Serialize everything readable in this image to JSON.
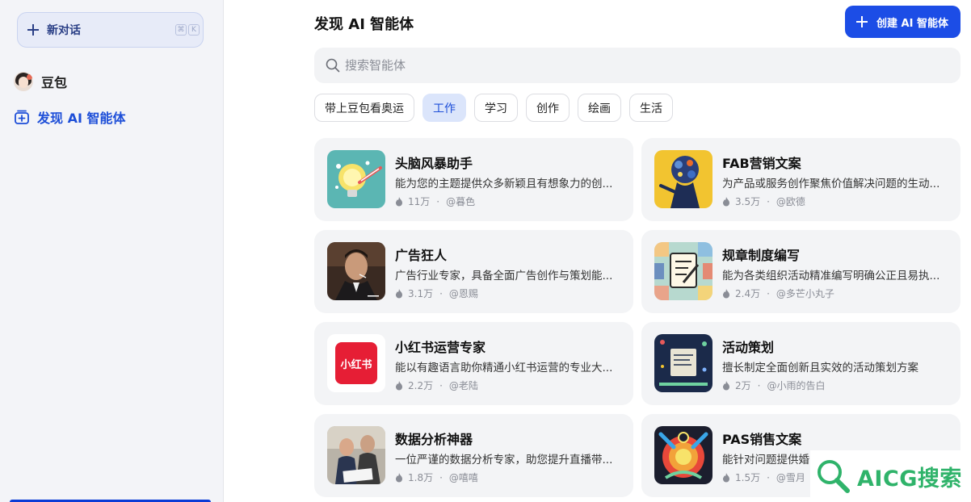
{
  "sidebar": {
    "new_chat_label": "新对话",
    "shortcut_keys": [
      "⌘",
      "K"
    ],
    "items": [
      {
        "label": "豆包",
        "icon": "avatar"
      },
      {
        "label": "发现 AI 智能体",
        "icon": "discover-icon"
      }
    ]
  },
  "header": {
    "title": "发现 AI 智能体",
    "create_button_label": "创建 AI 智能体"
  },
  "search": {
    "placeholder": "搜索智能体"
  },
  "tabs": [
    {
      "label": "带上豆包看奥运",
      "active": false
    },
    {
      "label": "工作",
      "active": true
    },
    {
      "label": "学习",
      "active": false
    },
    {
      "label": "创作",
      "active": false
    },
    {
      "label": "绘画",
      "active": false
    },
    {
      "label": "生活",
      "active": false
    }
  ],
  "agents": [
    {
      "name": "头脑风暴助手",
      "desc": "能为您的主题提供众多新颖且有想象力的创...",
      "count": "11万",
      "author": "@暮色"
    },
    {
      "name": "FAB营销文案",
      "desc": "为产品或服务创作聚焦价值解决问题的生动...",
      "count": "3.5万",
      "author": "@欧德"
    },
    {
      "name": "广告狂人",
      "desc": "广告行业专家，具备全面广告创作与策划能...",
      "count": "3.1万",
      "author": "@恩赐"
    },
    {
      "name": "规章制度编写",
      "desc": "能为各类组织活动精准编写明确公正且易执...",
      "count": "2.4万",
      "author": "@多芒小丸子"
    },
    {
      "name": "小红书运营专家",
      "desc": "能以有趣语言助你精通小红书运营的专业大...",
      "count": "2.2万",
      "author": "@老陆"
    },
    {
      "name": "活动策划",
      "desc": "擅长制定全面创新且实效的活动策划方案",
      "count": "2万",
      "author": "@小雨的告白"
    },
    {
      "name": "数据分析神器",
      "desc": "一位严谨的数据分析专家，助您提升直播带...",
      "count": "1.8万",
      "author": "@嘻嘻"
    },
    {
      "name": "PAS销售文案",
      "desc": "能针对问题提供婚",
      "count": "1.5万",
      "author": "@雪月"
    }
  ],
  "thumb_badges": {
    "xiaohongshu": "小红书"
  },
  "watermark": "AICG搜索",
  "colors": {
    "accent": "#1c4de6",
    "active_tab_bg": "#dbe5fb",
    "watermark": "#2fb36a"
  }
}
